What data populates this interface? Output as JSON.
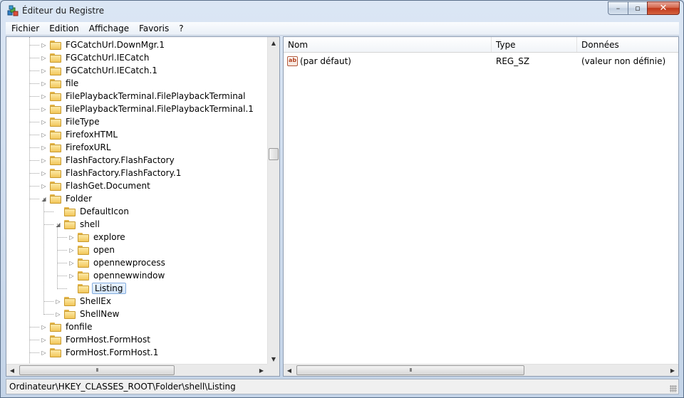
{
  "window": {
    "title": "Éditeur du Registre",
    "icon": "regedit-icon"
  },
  "titlebar": {
    "minimize_glyph": "–",
    "maximize_glyph": "▫",
    "close_glyph": "✕"
  },
  "menu": [
    "Fichier",
    "Edition",
    "Affichage",
    "Favoris",
    "?"
  ],
  "tree": {
    "items": [
      {
        "label": "FGCatchUrl.DownMgr.1",
        "level": 0,
        "expander": "collapsed"
      },
      {
        "label": "FGCatchUrl.IECatch",
        "level": 0,
        "expander": "collapsed"
      },
      {
        "label": "FGCatchUrl.IECatch.1",
        "level": 0,
        "expander": "collapsed"
      },
      {
        "label": "file",
        "level": 0,
        "expander": "collapsed"
      },
      {
        "label": "FilePlaybackTerminal.FilePlaybackTerminal",
        "level": 0,
        "expander": "collapsed"
      },
      {
        "label": "FilePlaybackTerminal.FilePlaybackTerminal.1",
        "level": 0,
        "expander": "collapsed"
      },
      {
        "label": "FileType",
        "level": 0,
        "expander": "collapsed"
      },
      {
        "label": "FirefoxHTML",
        "level": 0,
        "expander": "collapsed"
      },
      {
        "label": "FirefoxURL",
        "level": 0,
        "expander": "collapsed"
      },
      {
        "label": "FlashFactory.FlashFactory",
        "level": 0,
        "expander": "collapsed"
      },
      {
        "label": "FlashFactory.FlashFactory.1",
        "level": 0,
        "expander": "collapsed"
      },
      {
        "label": "FlashGet.Document",
        "level": 0,
        "expander": "collapsed"
      },
      {
        "label": "Folder",
        "level": 0,
        "expander": "expanded"
      },
      {
        "label": "DefaultIcon",
        "level": 1,
        "expander": "none"
      },
      {
        "label": "shell",
        "level": 1,
        "expander": "expanded"
      },
      {
        "label": "explore",
        "level": 2,
        "expander": "collapsed"
      },
      {
        "label": "open",
        "level": 2,
        "expander": "collapsed"
      },
      {
        "label": "opennewprocess",
        "level": 2,
        "expander": "collapsed"
      },
      {
        "label": "opennewwindow",
        "level": 2,
        "expander": "collapsed"
      },
      {
        "label": "Listing",
        "level": 2,
        "expander": "none",
        "selected": true
      },
      {
        "label": "ShellEx",
        "level": 1,
        "expander": "collapsed"
      },
      {
        "label": "ShellNew",
        "level": 1,
        "expander": "collapsed"
      },
      {
        "label": "fonfile",
        "level": 0,
        "expander": "collapsed"
      },
      {
        "label": "FormHost.FormHost",
        "level": 0,
        "expander": "collapsed"
      },
      {
        "label": "FormHost.FormHost.1",
        "level": 0,
        "expander": "collapsed"
      }
    ]
  },
  "list": {
    "columns": [
      "Nom",
      "Type",
      "Données"
    ],
    "rows": [
      {
        "icon": "reg-sz-icon",
        "icon_text": "ab",
        "name": "(par défaut)",
        "type": "REG_SZ",
        "data": "(valeur non définie)"
      }
    ]
  },
  "scrollbar": {
    "grip_glyph": "III"
  },
  "status": {
    "path": "Ordinateur\\HKEY_CLASSES_ROOT\\Folder\\shell\\Listing"
  },
  "colors": {
    "selection_border": "#84acdd",
    "selection_fill": "#d3e6fb",
    "folder": "#f2c65a"
  }
}
